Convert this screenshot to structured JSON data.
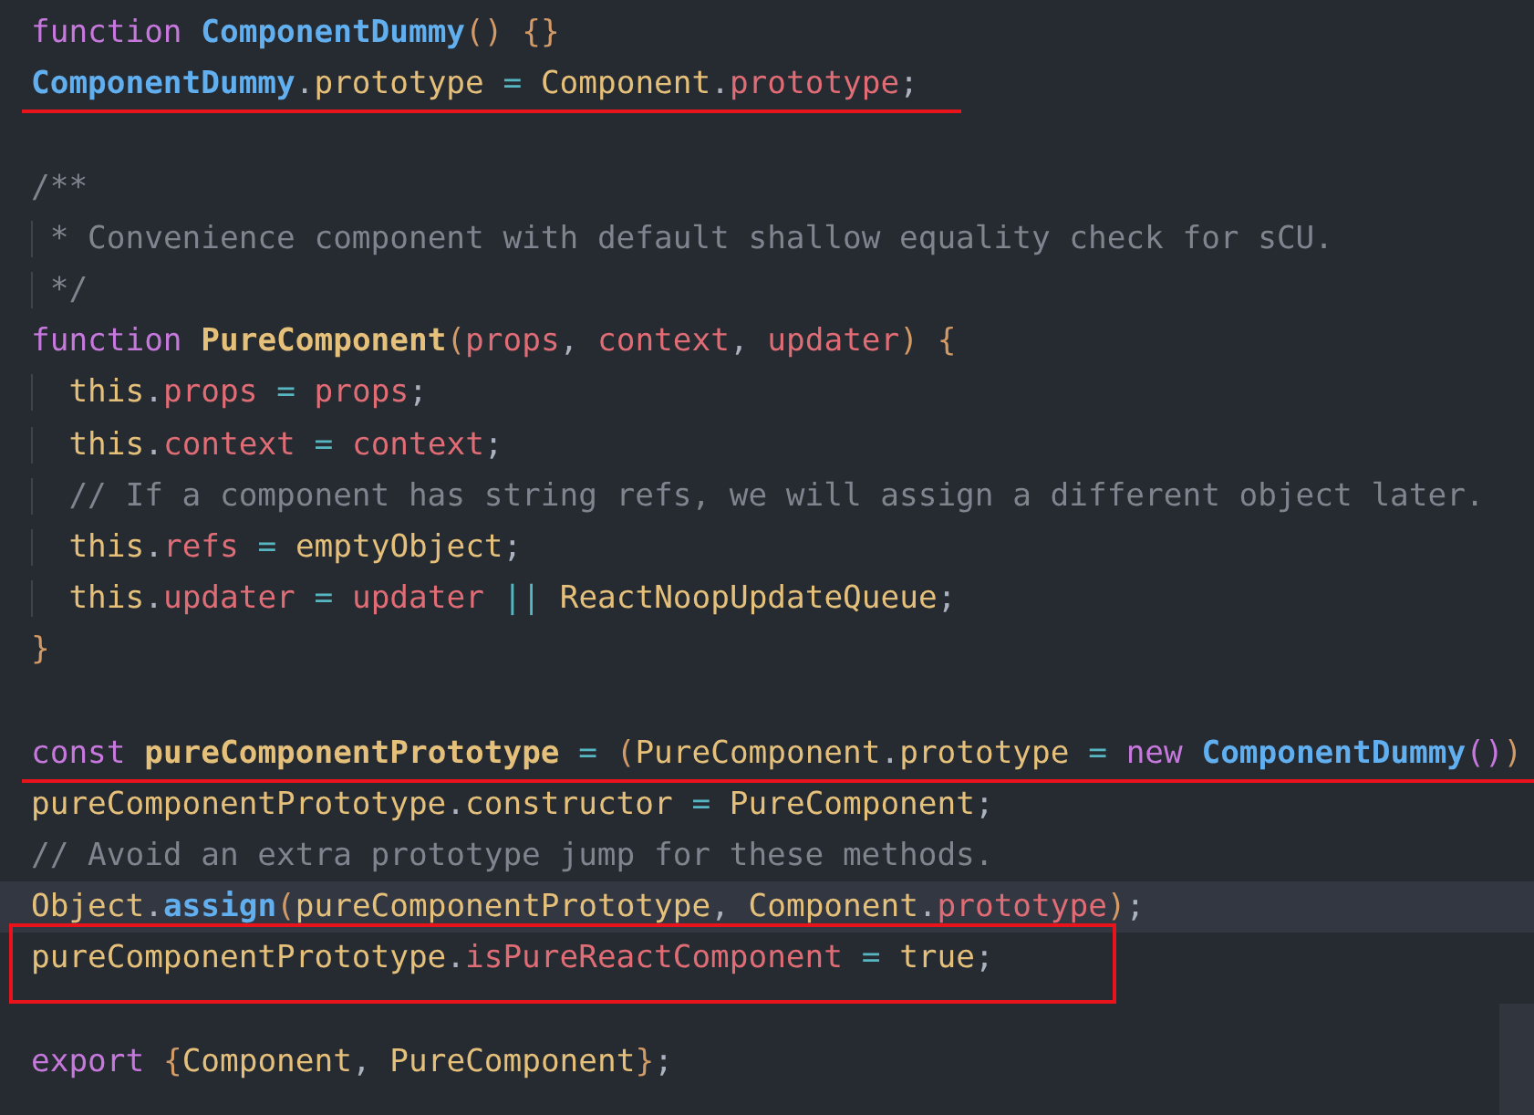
{
  "editor": {
    "lines": [
      {
        "current": false,
        "tokens": [
          {
            "kind": "kw",
            "t": "function"
          },
          {
            "kind": "fn",
            "t": " ComponentDummy"
          },
          {
            "kind": "paren",
            "t": "()"
          },
          {
            "kind": "brace",
            "t": " {}"
          }
        ]
      },
      {
        "current": false,
        "annotation": {
          "kind": "underline"
        },
        "tokens": [
          {
            "kind": "fn",
            "t": "ComponentDummy"
          },
          {
            "kind": "punct",
            "t": "."
          },
          {
            "kind": "id",
            "t": "prototype"
          },
          {
            "kind": "op",
            "t": " ="
          },
          {
            "kind": "id",
            "t": " Component"
          },
          {
            "kind": "punct",
            "t": "."
          },
          {
            "kind": "prop",
            "t": "prototype"
          },
          {
            "kind": "punct",
            "t": ";"
          }
        ]
      },
      {
        "current": false
      },
      {
        "current": false,
        "tokens": [
          {
            "kind": "comment",
            "t": "/**"
          }
        ]
      },
      {
        "current": false,
        "tokens": [
          {
            "kind": "comment",
            "t": " * Convenience component with default shallow equality check for sCU."
          }
        ]
      },
      {
        "current": false,
        "tokens": [
          {
            "kind": "comment",
            "t": " */"
          }
        ]
      },
      {
        "current": false,
        "tokens": [
          {
            "kind": "kw",
            "t": "function"
          },
          {
            "kind": "idb",
            "t": " PureComponent"
          },
          {
            "kind": "brace",
            "t": "("
          },
          {
            "kind": "prop",
            "t": "props"
          },
          {
            "kind": "punct",
            "t": ","
          },
          {
            "kind": "prop",
            "t": " context"
          },
          {
            "kind": "punct",
            "t": ","
          },
          {
            "kind": "prop",
            "t": " updater"
          },
          {
            "kind": "brace",
            "t": ")"
          },
          {
            "kind": "brace",
            "t": " {"
          }
        ]
      },
      {
        "current": false,
        "tokens": [
          {
            "kind": "id",
            "t": "  this"
          },
          {
            "kind": "punct",
            "t": "."
          },
          {
            "kind": "prop",
            "t": "props"
          },
          {
            "kind": "op",
            "t": " ="
          },
          {
            "kind": "prop",
            "t": " props"
          },
          {
            "kind": "punct",
            "t": ";"
          }
        ]
      },
      {
        "current": false,
        "tokens": [
          {
            "kind": "id",
            "t": "  this"
          },
          {
            "kind": "punct",
            "t": "."
          },
          {
            "kind": "prop",
            "t": "context"
          },
          {
            "kind": "op",
            "t": " ="
          },
          {
            "kind": "prop",
            "t": " context"
          },
          {
            "kind": "punct",
            "t": ";"
          }
        ]
      },
      {
        "current": false,
        "tokens": [
          {
            "kind": "comment",
            "t": "  // If a component has string refs, we will assign a different object later."
          }
        ]
      },
      {
        "current": false,
        "tokens": [
          {
            "kind": "id",
            "t": "  this"
          },
          {
            "kind": "punct",
            "t": "."
          },
          {
            "kind": "prop",
            "t": "refs"
          },
          {
            "kind": "op",
            "t": " ="
          },
          {
            "kind": "id",
            "t": " emptyObject"
          },
          {
            "kind": "punct",
            "t": ";"
          }
        ]
      },
      {
        "current": false,
        "tokens": [
          {
            "kind": "id",
            "t": "  this"
          },
          {
            "kind": "punct",
            "t": "."
          },
          {
            "kind": "prop",
            "t": "updater"
          },
          {
            "kind": "op",
            "t": " ="
          },
          {
            "kind": "prop",
            "t": " updater"
          },
          {
            "kind": "op",
            "t": " ||"
          },
          {
            "kind": "id",
            "t": " ReactNoopUpdateQueue"
          },
          {
            "kind": "punct",
            "t": ";"
          }
        ]
      },
      {
        "current": false,
        "tokens": [
          {
            "kind": "brace",
            "t": "}"
          }
        ]
      },
      {
        "current": false
      },
      {
        "current": false,
        "annotation": {
          "kind": "underline-long"
        },
        "tokens": [
          {
            "kind": "kw",
            "t": "const"
          },
          {
            "kind": "idb",
            "t": " pureComponentPrototype"
          },
          {
            "kind": "op",
            "t": " ="
          },
          {
            "kind": "brace",
            "t": " ("
          },
          {
            "kind": "id",
            "t": "PureComponent"
          },
          {
            "kind": "punct",
            "t": "."
          },
          {
            "kind": "id",
            "t": "prototype"
          },
          {
            "kind": "op",
            "t": " ="
          },
          {
            "kind": "kw",
            "t": " new"
          },
          {
            "kind": "fn",
            "t": " ComponentDummy"
          },
          {
            "kind": "kwparen",
            "t": "()"
          },
          {
            "kind": "brace",
            "t": ")"
          }
        ]
      },
      {
        "current": false,
        "tokens": [
          {
            "kind": "id",
            "t": "pureComponentPrototype"
          },
          {
            "kind": "punct",
            "t": "."
          },
          {
            "kind": "id",
            "t": "constructor"
          },
          {
            "kind": "op",
            "t": " ="
          },
          {
            "kind": "id",
            "t": " PureComponent"
          },
          {
            "kind": "punct",
            "t": ";"
          }
        ]
      },
      {
        "current": false,
        "tokens": [
          {
            "kind": "comment",
            "t": "// Avoid an extra prototype jump for these methods."
          }
        ]
      },
      {
        "current": true,
        "tokens": [
          {
            "kind": "id",
            "t": "Object"
          },
          {
            "kind": "punct",
            "t": "."
          },
          {
            "kind": "fn",
            "t": "assign"
          },
          {
            "kind": "brace",
            "t": "("
          },
          {
            "kind": "id",
            "t": "pureComponentPrototype"
          },
          {
            "kind": "punct",
            "t": ","
          },
          {
            "kind": "id",
            "t": " Component"
          },
          {
            "kind": "punct",
            "t": "."
          },
          {
            "kind": "prop",
            "t": "prototype"
          },
          {
            "kind": "brace",
            "t": ")"
          },
          {
            "kind": "punct",
            "t": ";"
          }
        ]
      },
      {
        "current": false,
        "annotation": {
          "kind": "box"
        },
        "tokens": [
          {
            "kind": "id",
            "t": "pureComponentPrototype"
          },
          {
            "kind": "punct",
            "t": "."
          },
          {
            "kind": "prop",
            "t": "isPureReactComponent"
          },
          {
            "kind": "op",
            "t": " ="
          },
          {
            "kind": "id",
            "t": " true"
          },
          {
            "kind": "punct",
            "t": ";"
          }
        ]
      },
      {
        "current": false
      },
      {
        "current": false,
        "tokens": [
          {
            "kind": "kw",
            "t": "export"
          },
          {
            "kind": "brace",
            "t": " {"
          },
          {
            "kind": "id",
            "t": "Component"
          },
          {
            "kind": "punct",
            "t": ","
          },
          {
            "kind": "id",
            "t": " PureComponent"
          },
          {
            "kind": "brace",
            "t": "}"
          },
          {
            "kind": "punct",
            "t": ";"
          }
        ]
      }
    ]
  }
}
